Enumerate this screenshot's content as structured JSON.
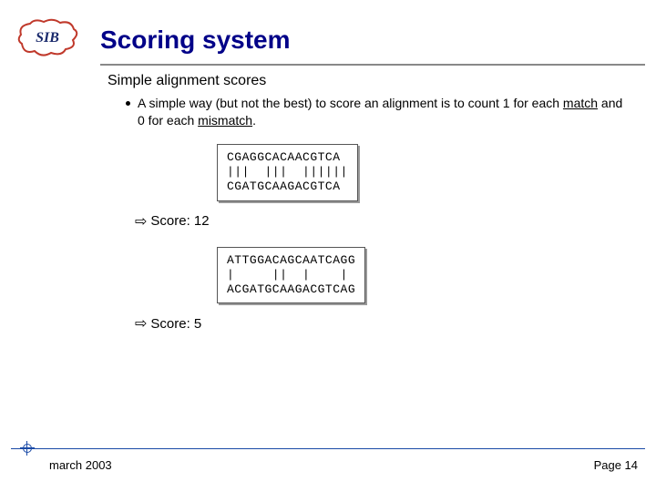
{
  "slide": {
    "logo_label": "SIB",
    "title": "Scoring system",
    "subheading": "Simple alignment scores",
    "bullet": "A simple way (but not the best) to score an alignment is to count 1 for each match and 0 for each mismatch.",
    "example1": {
      "seq1": "CGAGGCACAACGTCA",
      "match": "|||  |||  ||||||",
      "seq2": "CGATGCAAGACGTCA",
      "score_label": "Score: 12"
    },
    "example2": {
      "seq1": "ATTGGACAGCAATCAGG",
      "match": "|     ||  |    |",
      "seq2": "ACGATGCAAGACGTCAG",
      "score_label": "Score: 5"
    },
    "footer": {
      "date": "march 2003",
      "page": "Page 14"
    }
  }
}
